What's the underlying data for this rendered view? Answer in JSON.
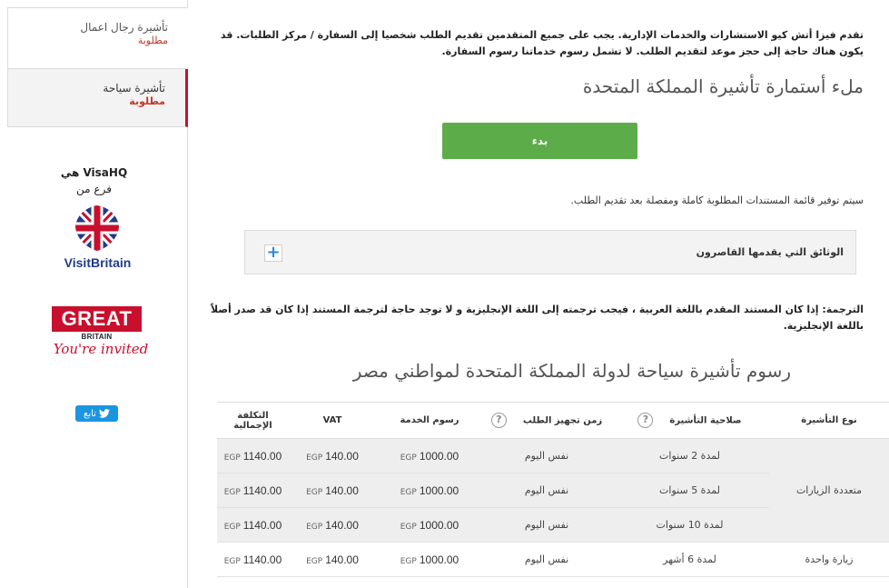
{
  "sidebar": {
    "items": [
      {
        "title": "تأشيرة رجال اعمال",
        "status": "مطلوبة"
      },
      {
        "title": "تأشيرة سياحة",
        "status": "مطلوبة"
      }
    ],
    "brand_line1": "VisaHQ هي",
    "brand_line2": "فرع من",
    "visitbritain_logo": "VisitBritain",
    "great_logo": "GREAT",
    "great_sub": "BRITAIN",
    "great_tagline": "You're invited",
    "tweet_label": "تابع",
    "colors": {
      "accent": "#c8102e",
      "twitter": "#1b95e0"
    }
  },
  "main": {
    "notice": "تقدم فيزا أتش كيو الاستشارات والخدمات الإدارية. يجب على جميع المتقدمين تقديم الطلب شخصيا إلى السفارة / مركز الطلبات. قد يكون هناك حاجة إلى حجز موعد لتقديم الطلب. لا تشمل رسوم خدماتنا رسوم السفارة.",
    "form_heading": "ملء أستمارة تأشيرة المملكة المتحدة",
    "start_button": "بدء",
    "start_button_color": "#5cad4a",
    "info_line": "سيتم توفير قائمة المستندات المطلوبة كاملة ومفصلة بعد تقديم الطلب.",
    "accordion_label": "الوثائق التي يقدمها القاصرون",
    "accordion_icon": "plus-icon",
    "translation_note": "الترجمة: إذا كان المستند المقدم باللغة العربية ، فيجب ترجمته إلى اللغة الإنجليزية و لا توجد حاجة لترجمة المستند إذا كان قد صدر أصلاً باللغة الإنجليزية.",
    "fees_heading": "رسوم تأشيرة سياحة لدولة المملكة المتحدة لمواطني مصر",
    "table": {
      "headers": [
        "نوع التأشيرة",
        "صلاحية التأشيرة",
        "زمن تجهيز الطلب",
        "رسوم الخدمة",
        "VAT",
        "التكلفة الإجمالية"
      ],
      "header_icon": "question-icon",
      "currency": "EGP",
      "groups": [
        {
          "type": "متعددة الزيارات",
          "rows": [
            {
              "validity": "لمدة 2 سنوات",
              "processing": "نفس اليوم",
              "service": "1000.00",
              "vat": "140.00",
              "total": "1140.00"
            },
            {
              "validity": "لمدة 5 سنوات",
              "processing": "نفس اليوم",
              "service": "1000.00",
              "vat": "140.00",
              "total": "1140.00"
            },
            {
              "validity": "لمدة 10 سنوات",
              "processing": "نفس اليوم",
              "service": "1000.00",
              "vat": "140.00",
              "total": "1140.00"
            }
          ]
        },
        {
          "type": "زيارة واحدة",
          "rows": [
            {
              "validity": "لمدة 6 أشهر",
              "processing": "نفس اليوم",
              "service": "1000.00",
              "vat": "140.00",
              "total": "1140.00"
            }
          ]
        }
      ]
    }
  }
}
